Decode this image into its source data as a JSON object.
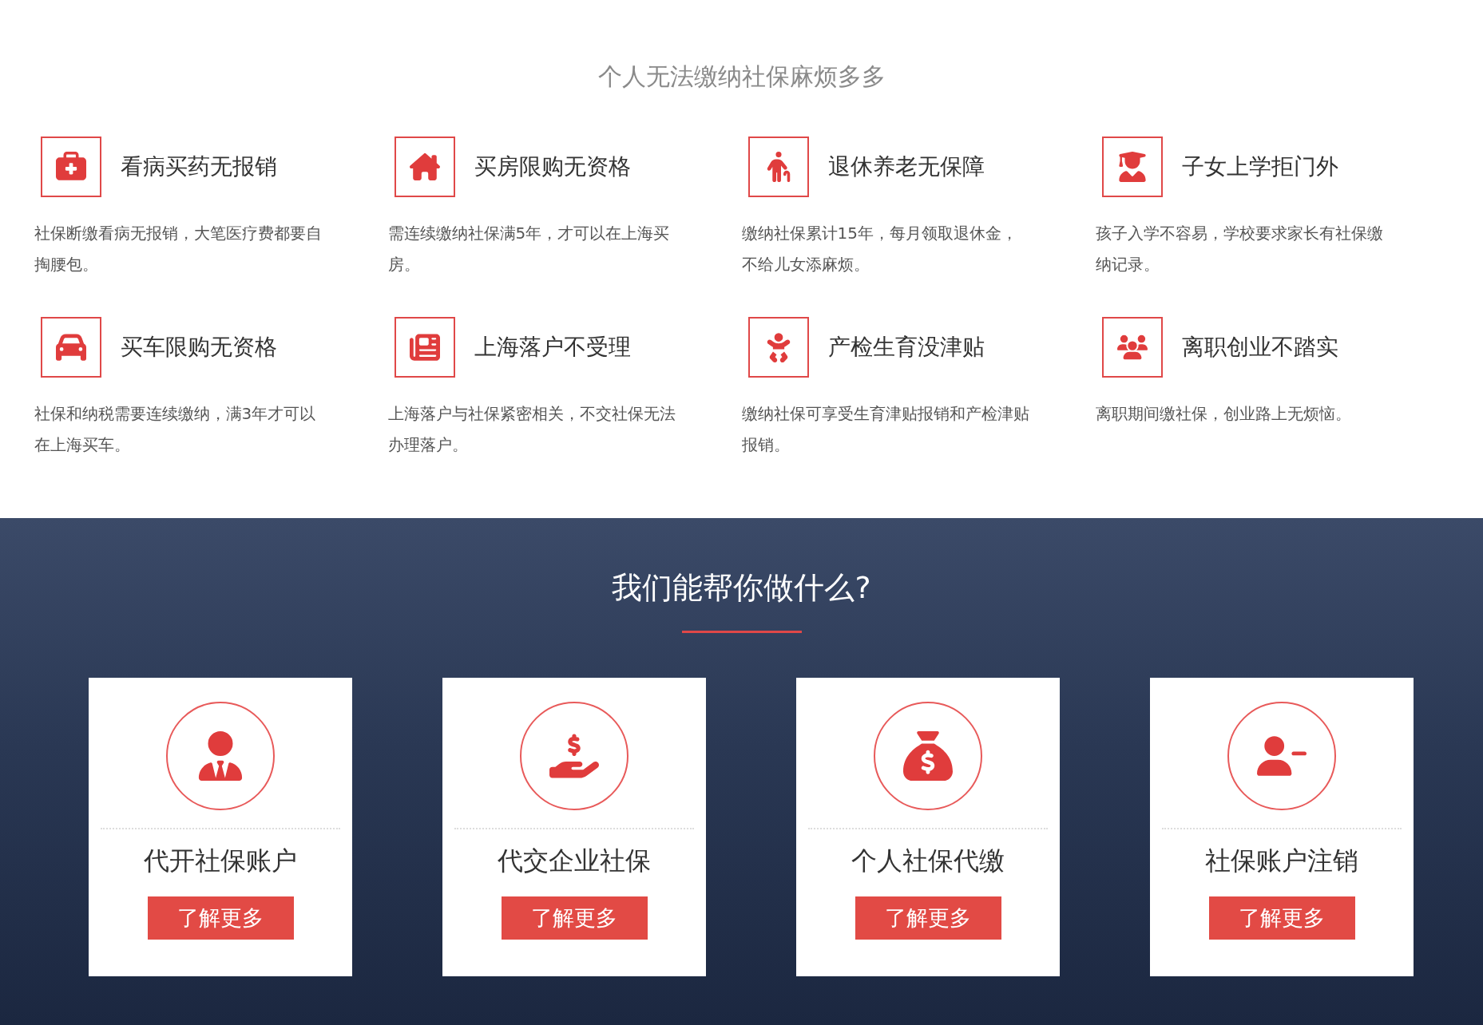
{
  "problems": {
    "title": "个人无法缴纳社保麻烦多多",
    "items": [
      {
        "title": "看病买药无报销",
        "text": "社保断缴看病无报销，大笔医疗费都要自掏腰包。"
      },
      {
        "title": "买房限购无资格",
        "text": "需连续缴纳社保满5年，才可以在上海买房。"
      },
      {
        "title": "退休养老无保障",
        "text": "缴纳社保累计15年，每月领取退休金，不给儿女添麻烦。"
      },
      {
        "title": "子女上学拒门外",
        "text": "孩子入学不容易，学校要求家长有社保缴纳记录。"
      },
      {
        "title": "买车限购无资格",
        "text": "社保和纳税需要连续缴纳，满3年才可以在上海买车。"
      },
      {
        "title": "上海落户不受理",
        "text": "上海落户与社保紧密相关，不交社保无法办理落户。"
      },
      {
        "title": "产检生育没津贴",
        "text": "缴纳社保可享受生育津贴报销和产检津贴报销。"
      },
      {
        "title": "离职创业不踏实",
        "text": "离职期间缴社保，创业路上无烦恼。"
      }
    ]
  },
  "services": {
    "title": "我们能帮你做什么?",
    "cards": [
      {
        "title": "代开社保账户",
        "button": "了解更多"
      },
      {
        "title": "代交企业社保",
        "button": "了解更多"
      },
      {
        "title": "个人社保代缴",
        "button": "了解更多"
      },
      {
        "title": "社保账户注销",
        "button": "了解更多"
      }
    ]
  }
}
